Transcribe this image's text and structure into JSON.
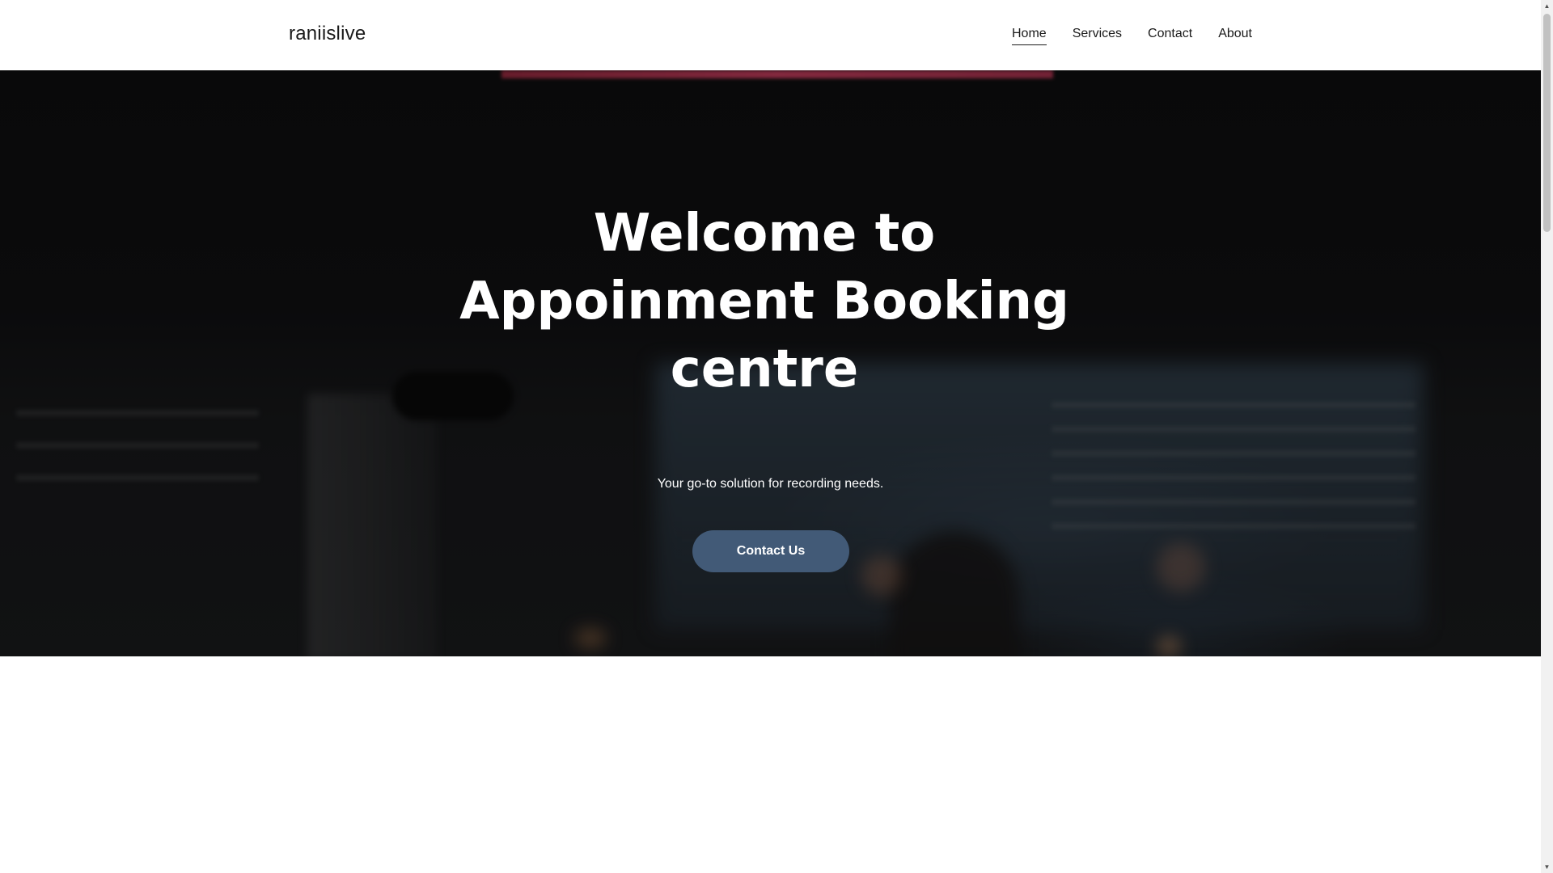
{
  "header": {
    "brand": "raniislive",
    "nav": [
      {
        "label": "Home",
        "active": true
      },
      {
        "label": "Services",
        "active": false
      },
      {
        "label": "Contact",
        "active": false
      },
      {
        "label": "About",
        "active": false
      }
    ]
  },
  "hero": {
    "title_lines": [
      "Welcome to",
      "Appoinment Booking",
      "centre"
    ],
    "subtitle": "Your go-to solution for recording needs.",
    "cta_label": "Contact Us"
  },
  "scrollbar": {
    "up_icon": "arrow-up-icon",
    "down_icon": "arrow-down-icon"
  },
  "colors": {
    "cta_background": "#425a77",
    "hero_text": "#ffffff",
    "header_background": "#ffffff"
  }
}
